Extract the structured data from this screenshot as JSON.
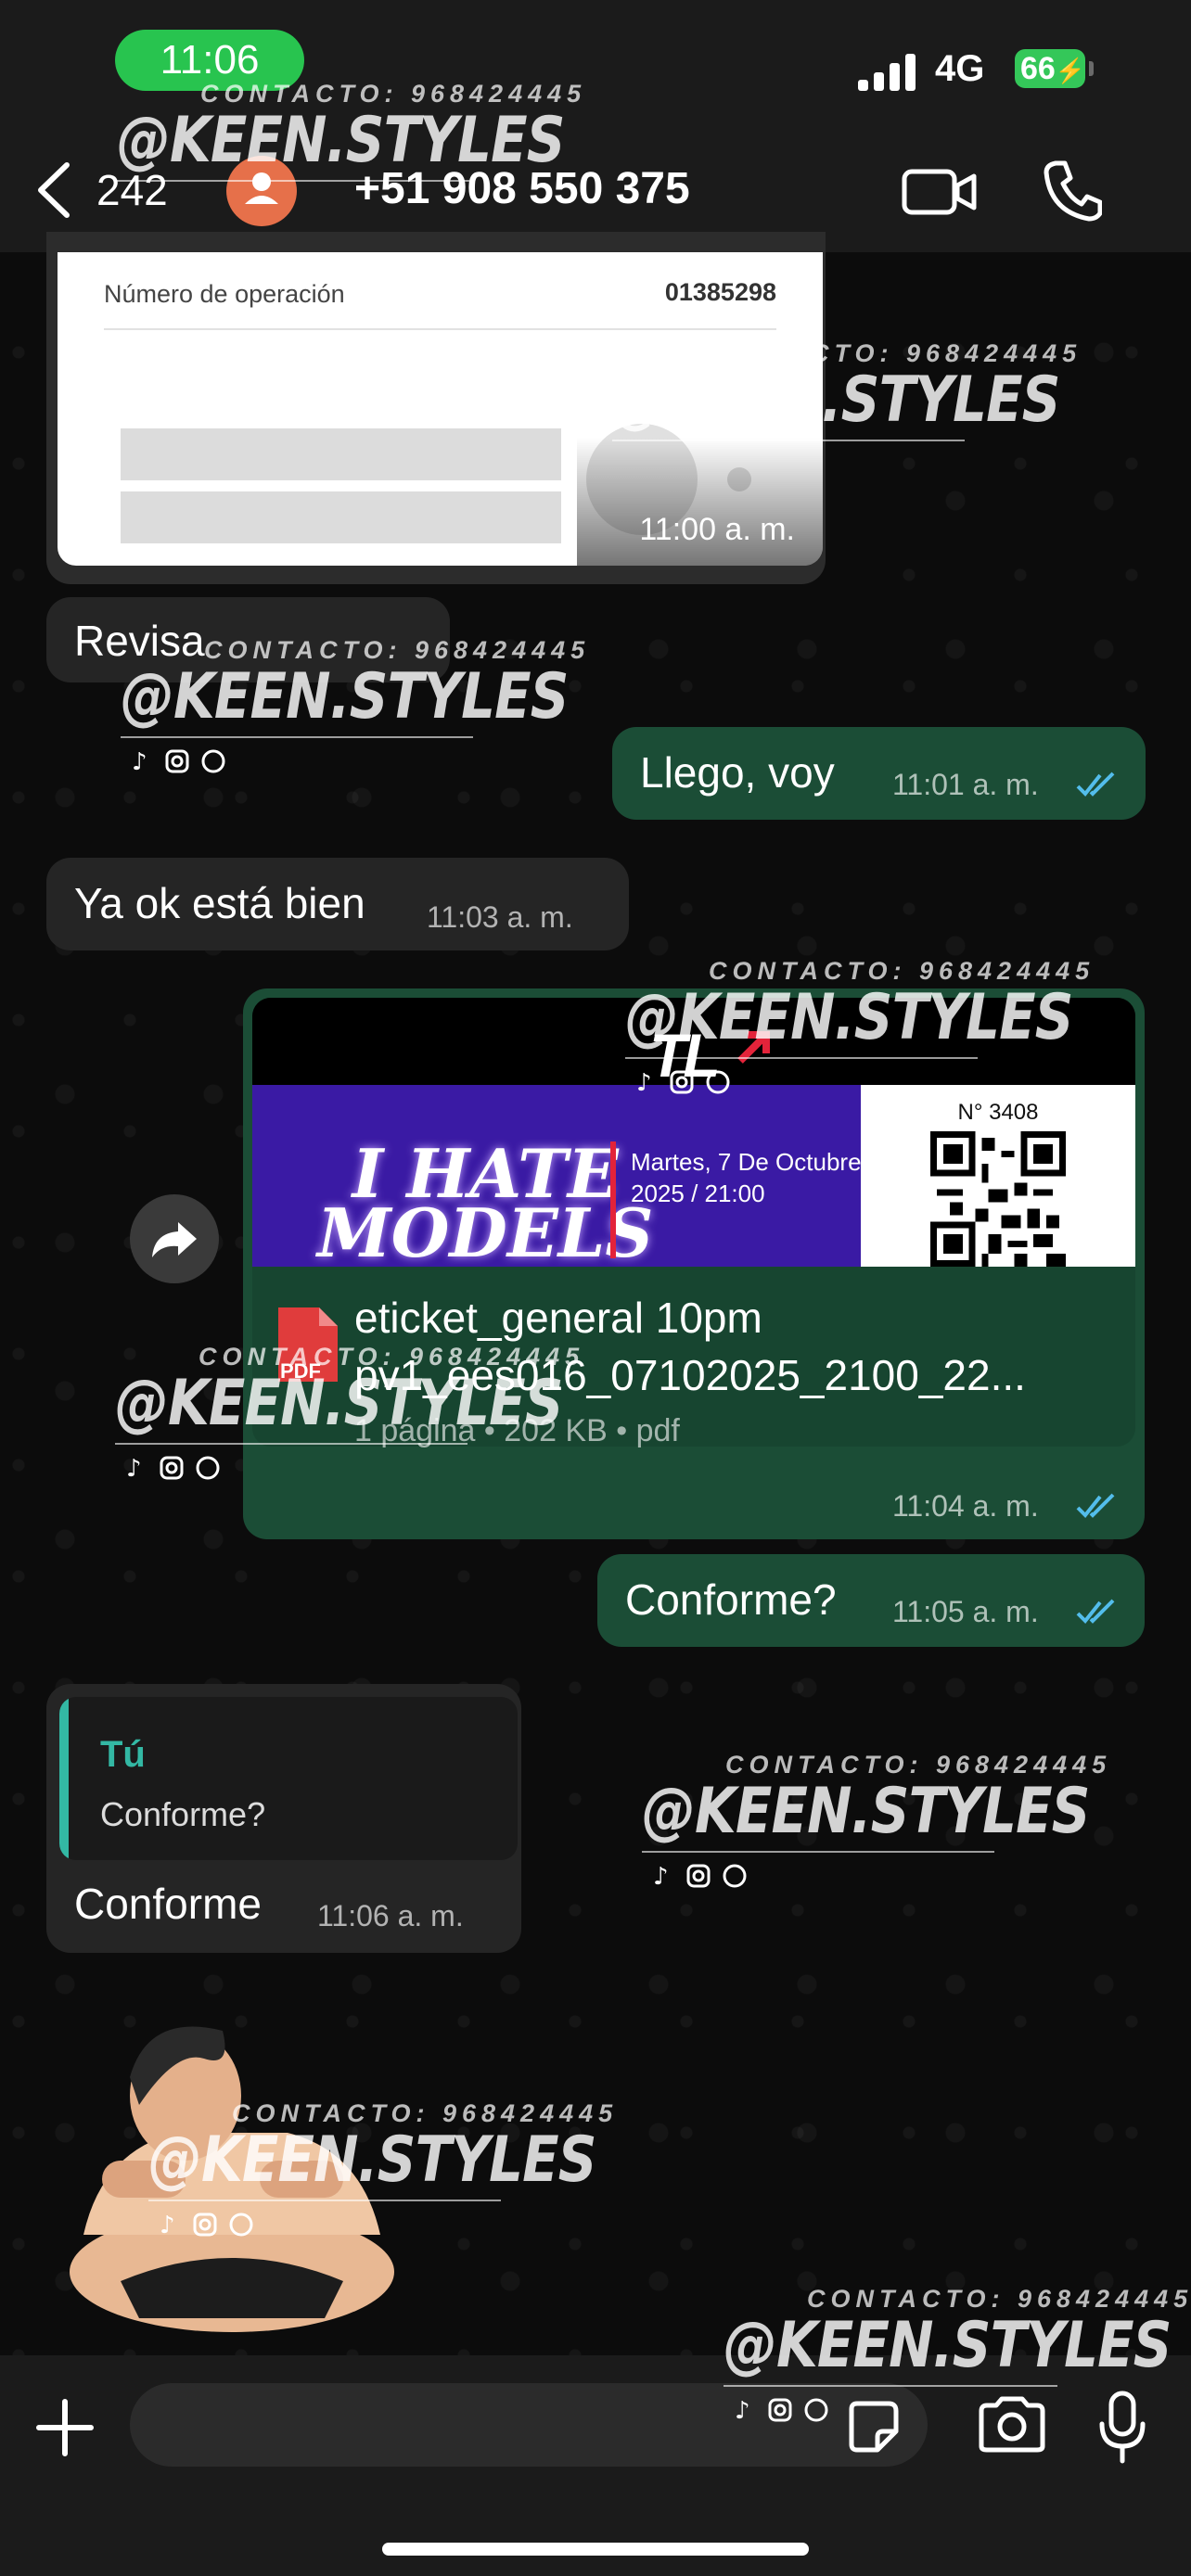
{
  "status_bar": {
    "time": "11:06",
    "network": "4G",
    "battery": "66"
  },
  "header": {
    "unread_count": "242",
    "contact_name": "+51 908 550 375"
  },
  "receipt": {
    "label": "Número de operación",
    "value": "01385298",
    "time": "11:00 a. m."
  },
  "messages": [
    {
      "id": "m1",
      "direction": "incoming",
      "text": "Revisa",
      "time": ""
    },
    {
      "id": "m2",
      "direction": "outgoing",
      "text": "Llego, voy",
      "time": "11:01 a. m.",
      "status": "read"
    },
    {
      "id": "m3",
      "direction": "incoming",
      "text": "Ya ok está bien",
      "time": "11:03 a. m."
    },
    {
      "id": "m5",
      "direction": "outgoing",
      "text": "Conforme?",
      "time": "11:05 a. m.",
      "status": "read"
    },
    {
      "id": "m6",
      "direction": "incoming",
      "text": "Conforme",
      "time": "11:06 a. m."
    }
  ],
  "document": {
    "brand": "TL",
    "title_line1": "I HATE",
    "title_line2": "MODELS",
    "date_line1": "Martes, 7 De Octubre",
    "date_line2": "2025 / 21:00",
    "ticket_number": "N° 3408",
    "pdf_badge": "PDF",
    "file_name_line1": "eticket_general 10pm",
    "file_name_line2": "pv1_ees016_07102025_2100_22...",
    "meta": "1 página • 202 KB • pdf",
    "time": "11:04 a. m.",
    "status": "read"
  },
  "reply": {
    "quote_author": "Tú",
    "quote_text": "Conforme?"
  },
  "watermark": {
    "contact": "CONTACTO: 968424445",
    "brand": "@KEEN.STYLES"
  },
  "input_bar": {
    "placeholder": ""
  },
  "colors": {
    "outgoing_bubble": "#1b4d36",
    "incoming_bubble": "#252525",
    "accent_teal": "#33b8a4",
    "read_ticks": "#53bdeb",
    "time_pill": "#28c44f"
  },
  "icons": {
    "back": "chevron-left-icon",
    "video": "video-camera-icon",
    "call": "phone-icon",
    "forward": "share-forward-icon",
    "plus": "plus-icon",
    "sticker": "sticker-icon",
    "camera": "camera-icon",
    "mic": "microphone-icon"
  }
}
